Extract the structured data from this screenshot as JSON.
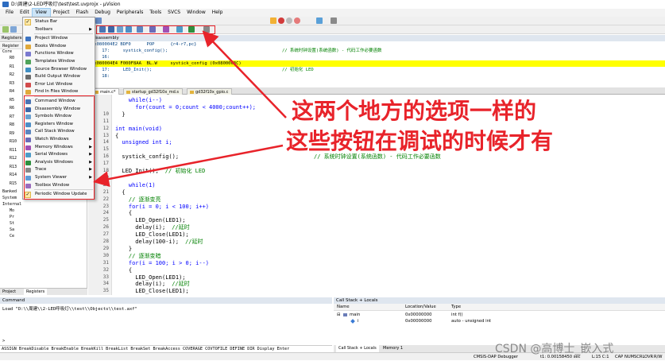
{
  "window": {
    "title": "D:\\周建\\2-LED呼吸灯\\test\\test.uvprojx - µVision"
  },
  "menubar": [
    "File",
    "Edit",
    "View",
    "Project",
    "Flash",
    "Debug",
    "Peripherals",
    "Tools",
    "SVCS",
    "Window",
    "Help"
  ],
  "view_menu": {
    "items": [
      {
        "label": "Status Bar",
        "checked": true
      },
      {
        "label": "Toolbars",
        "submenu": true
      },
      {
        "label": "Project Window"
      },
      {
        "label": "Books Window"
      },
      {
        "label": "Functions Window"
      },
      {
        "label": "Templates Window"
      },
      {
        "label": "Source Browser Window"
      },
      {
        "label": "Build Output Window"
      },
      {
        "label": "Error List Window"
      },
      {
        "label": "Find In Files Window"
      },
      {
        "label": "Command Window"
      },
      {
        "label": "Disassembly Window"
      },
      {
        "label": "Symbols Window"
      },
      {
        "label": "Registers Window"
      },
      {
        "label": "Call Stack Window"
      },
      {
        "label": "Watch Windows",
        "submenu": true
      },
      {
        "label": "Memory Windows",
        "submenu": true
      },
      {
        "label": "Serial Windows",
        "submenu": true
      },
      {
        "label": "Analysis Windows",
        "submenu": true
      },
      {
        "label": "Trace",
        "submenu": true
      },
      {
        "label": "System Viewer",
        "submenu": true
      },
      {
        "label": "Toolbox Window"
      },
      {
        "label": "Periodic Window Update",
        "checked": true
      }
    ]
  },
  "left_pane": {
    "header": "Registers",
    "col_header": "Register",
    "tree": [
      "Core",
      "R0",
      "R1",
      "R2",
      "R3",
      "R4",
      "R5",
      "R6",
      "R7",
      "R8",
      "R9",
      "R10",
      "R11",
      "R12",
      "R13",
      "R14",
      "R15",
      "Banked",
      "System",
      "Internal",
      "Mo",
      "Pr",
      "St",
      "Sa",
      "Ce"
    ],
    "tabs": [
      "Project",
      "Registers"
    ]
  },
  "disassembly": {
    "title": "Disassembly",
    "lines": [
      {
        "text": "0x080004E2 BDF0      POP      {r4-r7,pc}",
        "comment": ""
      },
      {
        "text": "    17:     systick_config();",
        "comment": "// 系统时钟设置(系统函数) - 代码工作必要函数"
      },
      {
        "text": "    16:",
        "comment": ""
      },
      {
        "text": "0x080004E4 F000F8AA  BL.W     systick_config (0x0800063C)",
        "comment": "",
        "highlight": true
      },
      {
        "text": "    17:     LED_Init();",
        "comment": "// 初始化 LED"
      },
      {
        "text": "    18:",
        "comment": ""
      }
    ]
  },
  "editor": {
    "tabs": [
      "main.c*",
      "startup_gd32f10x_md.s",
      "gd32f10x_gpio.c"
    ],
    "lines": [
      {
        "n": "",
        "code": "    while(i--)"
      },
      {
        "n": "",
        "code": "      for(count = 0;count < 4000;count++);"
      },
      {
        "n": "10",
        "code": "  }"
      },
      {
        "n": "11",
        "code": ""
      },
      {
        "n": "12",
        "code": "int main(void)"
      },
      {
        "n": "13",
        "code": "{"
      },
      {
        "n": "14",
        "code": "  unsigned int i;"
      },
      {
        "n": "15",
        "code": ""
      },
      {
        "n": "16",
        "code": "  systick_config();",
        "comment": "// 系统时钟设置(系统函数) - 代码工作必要函数"
      },
      {
        "n": "17",
        "code": ""
      },
      {
        "n": "18",
        "code": "  LED_Init();",
        "comment": "// 初始化 LED"
      },
      {
        "n": "19",
        "code": ""
      },
      {
        "n": "20",
        "code": "    while(1)"
      },
      {
        "n": "21",
        "code": "  {"
      },
      {
        "n": "22",
        "code": "    ",
        "comment": "// 逐渐变亮"
      },
      {
        "n": "23",
        "code": "    for(i = 0; i < 100; i++)"
      },
      {
        "n": "24",
        "code": "    {"
      },
      {
        "n": "25",
        "code": "      LED_Open(LED1);"
      },
      {
        "n": "26",
        "code": "      delay(i);",
        "comment": "//延时"
      },
      {
        "n": "27",
        "code": "      LED_Close(LED1);"
      },
      {
        "n": "28",
        "code": "      delay(100-i);",
        "comment": "//延时"
      },
      {
        "n": "29",
        "code": "    }"
      },
      {
        "n": "30",
        "code": "    ",
        "comment": "// 逐渐变暗"
      },
      {
        "n": "31",
        "code": "    for(i = 100; i > 0; i--)"
      },
      {
        "n": "32",
        "code": "    {"
      },
      {
        "n": "33",
        "code": "      LED_Open(LED1);"
      },
      {
        "n": "34",
        "code": "      delay(i);",
        "comment": "//延时"
      },
      {
        "n": "35",
        "code": "      LED_Close(LED1);"
      }
    ]
  },
  "annotation": {
    "line1": "这两个地方的选项一样的",
    "line2": "这些按钮在调试的时候才有",
    "color": "#e8232a"
  },
  "command": {
    "title": "Command",
    "output": "Load \"D:\\\\周建\\\\2-LED呼吸灯\\\\test\\\\Objects\\\\test.axf\"",
    "prompt": ">",
    "hints": "ASSIGN BreakDisable BreakEnable BreakKill BreakList BreakSet BreakAccess COVERAGE COVTOFILE DEFINE DIR Display Enter"
  },
  "call_stack": {
    "title": "Call Stack + Locals",
    "headers": [
      "Name",
      "Location/Value",
      "Type"
    ],
    "rows": [
      {
        "name": "main",
        "value": "0x00000000",
        "type": "int f()"
      },
      {
        "name": "i",
        "value": "0x00000000",
        "type": "auto - unsigned int"
      }
    ],
    "tabs": [
      "Call Stack + Locals",
      "Memory 1"
    ]
  },
  "statusbar": {
    "debugger": "CMSIS-DAP Debugger",
    "time": "t1: 0.00158450 sec",
    "position": "L:15 C:1",
    "flags": [
      "CAP",
      "NUM",
      "SCRL",
      "OVR",
      "R/W"
    ]
  },
  "watermark": "CSDN @高博士_嵌入式"
}
